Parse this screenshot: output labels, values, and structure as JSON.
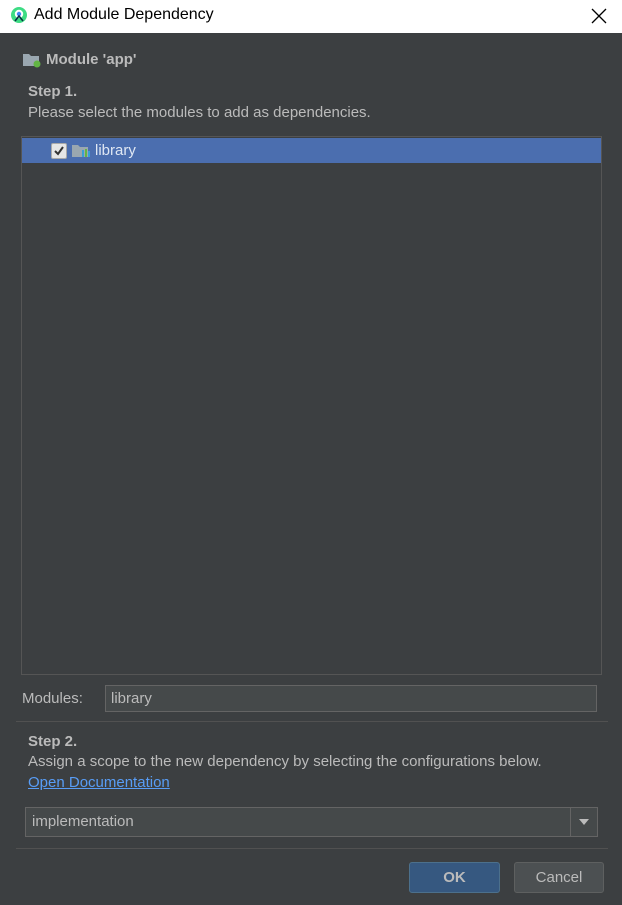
{
  "window": {
    "title": "Add Module Dependency"
  },
  "header": {
    "module_label": "Module 'app'"
  },
  "step1": {
    "title": "Step 1.",
    "description": "Please select the modules to add as dependencies."
  },
  "module_tree": {
    "items": [
      {
        "label": "library",
        "checked": true,
        "selected": true
      }
    ]
  },
  "modules_field": {
    "label": "Modules:",
    "value": "library"
  },
  "step2": {
    "title": "Step 2.",
    "description": "Assign a scope to the new dependency by selecting the configurations below.",
    "link": "Open Documentation"
  },
  "scope_select": {
    "value": "implementation"
  },
  "buttons": {
    "ok": "OK",
    "cancel": "Cancel"
  },
  "colors": {
    "selection": "#4b6eaf",
    "link": "#589df6",
    "background": "#3c3f41",
    "ok_button": "#365880"
  },
  "icons": {
    "app": "android-studio-icon",
    "close": "close-icon",
    "module": "module-folder-icon",
    "library": "library-module-icon",
    "dropdown": "chevron-down-icon"
  }
}
